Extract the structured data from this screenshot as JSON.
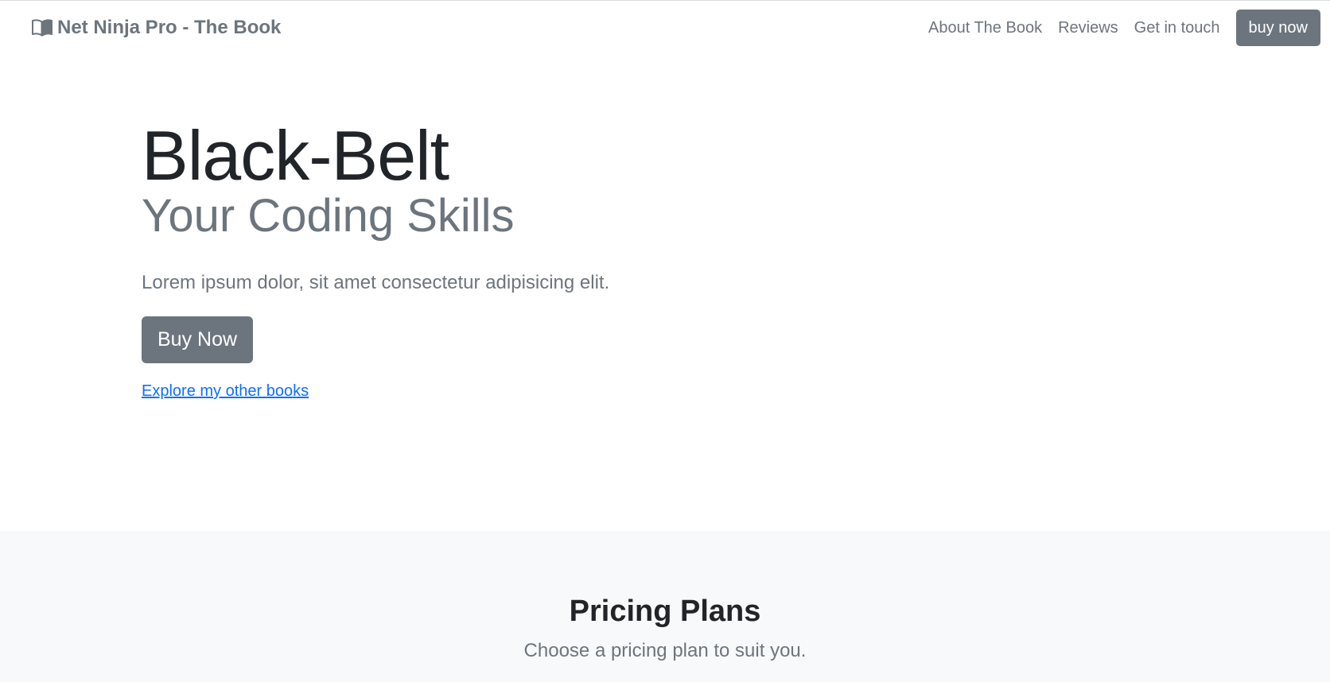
{
  "navbar": {
    "brand_icon": "open-book-icon",
    "brand_text": "Net Ninja Pro - The Book",
    "links": [
      "About The Book",
      "Reviews",
      "Get in touch"
    ],
    "cta_label": "buy now"
  },
  "hero": {
    "title": "Black-Belt",
    "subtitle": "Your Coding Skills",
    "lead": "Lorem ipsum dolor, sit amet consectetur adipisicing elit.",
    "button_label": "Buy Now",
    "link_text": "Explore my other books"
  },
  "pricing": {
    "title": "Pricing Plans",
    "subtitle": "Choose a pricing plan to suit you."
  },
  "colors": {
    "secondary": "#6c757d",
    "link": "#0d6efd",
    "light_bg": "#f8f9fa"
  }
}
